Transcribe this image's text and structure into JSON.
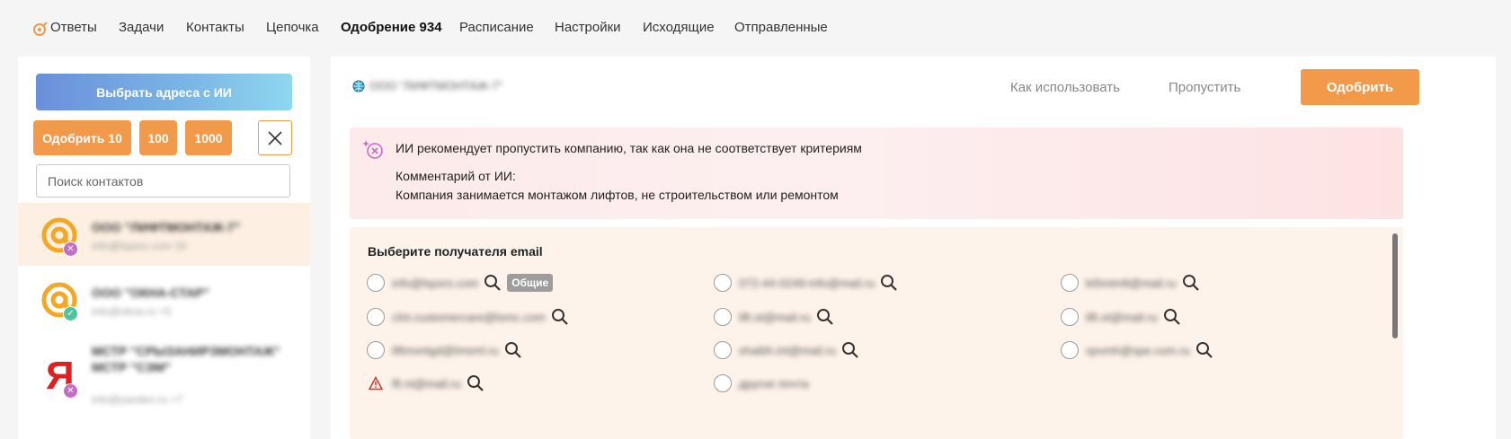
{
  "nav": {
    "items": [
      {
        "label": "Ответы",
        "active": false
      },
      {
        "label": "Задачи",
        "active": false
      },
      {
        "label": "Контакты",
        "active": false
      },
      {
        "label": "Цепочка",
        "active": false
      },
      {
        "label": "Одобрение 934",
        "active": true
      },
      {
        "label": "Расписание",
        "active": false
      },
      {
        "label": "Настройки",
        "active": false
      },
      {
        "label": "Исходящие",
        "active": false
      },
      {
        "label": "Отправленные",
        "active": false
      }
    ]
  },
  "left": {
    "ai_button": "Выбрать адреса с ИИ",
    "approve_buttons": [
      "Одобрить 10",
      "100",
      "1000"
    ],
    "close_icon": "close-icon",
    "search_placeholder": "Поиск контактов",
    "contacts": [
      {
        "name": "ООО \"ЛИФТМОНТАЖ-7\"",
        "email": "info@lspsrs.com 16",
        "icon": "mail-at-icon",
        "status": "rejected",
        "selected": true
      },
      {
        "name": "ООО \"ОКНА-СТАР\"",
        "email": "info@okna.ru +5",
        "icon": "mail-at-icon",
        "status": "approved",
        "selected": false
      },
      {
        "name": "МСТР \"СРЫЗАНИРЗМОНТАЖ\" МСТР \"СЭМ\"",
        "email": "info@yandex.ru +7",
        "icon": "yandex-icon",
        "status": "rejected",
        "selected": false
      }
    ]
  },
  "main": {
    "company_name": "ООО \"ЛИФТМОНТАЖ-7\"",
    "how_to_use": "Как использовать",
    "skip": "Пропустить",
    "approve": "Одобрить",
    "ai_warning": {
      "title": "ИИ рекомендует пропустить компанию, так как она не соответствует критериям",
      "comment_label": "Комментарий от ИИ:",
      "comment": "Компания занимается монтажом лифтов, не строительством или ремонтом"
    },
    "recipients": {
      "title": "Выберите получателя email",
      "emails": [
        {
          "text": "info@lspsrs.com",
          "tag": "Общие",
          "warning": false,
          "search": true
        },
        {
          "text": "072-44-0249-info@mail.ru",
          "tag": "",
          "warning": false,
          "search": true
        },
        {
          "text": "kt5mimlt@mail.ru",
          "tag": "",
          "warning": false,
          "search": true
        },
        {
          "text": "clnt.customercare@lsmc.com",
          "tag": "",
          "warning": false,
          "search": true
        },
        {
          "text": "lift.ot@mail.ru",
          "tag": "",
          "warning": false,
          "search": true
        },
        {
          "text": "lift.ot@mail.ru",
          "tag": "",
          "warning": false,
          "search": true
        },
        {
          "text": "liftmontgd@lmsml.ru",
          "tag": "",
          "warning": false,
          "search": true
        },
        {
          "text": "shaibh.int@mail.ru",
          "tag": "",
          "warning": false,
          "search": true
        },
        {
          "text": "spvmh@spe.com.ru",
          "tag": "",
          "warning": false,
          "search": true
        },
        {
          "text": "lft.nt@mail.ru",
          "tag": "",
          "warning": true,
          "search": true
        },
        {
          "text": "другое почта",
          "tag": "",
          "warning": false,
          "search": false
        }
      ]
    }
  },
  "colors": {
    "accent": "#f2994a",
    "selected_bg": "#fdf0e3",
    "warn_bg": "#fdeaea",
    "recip_bg": "#fdf3ea"
  }
}
